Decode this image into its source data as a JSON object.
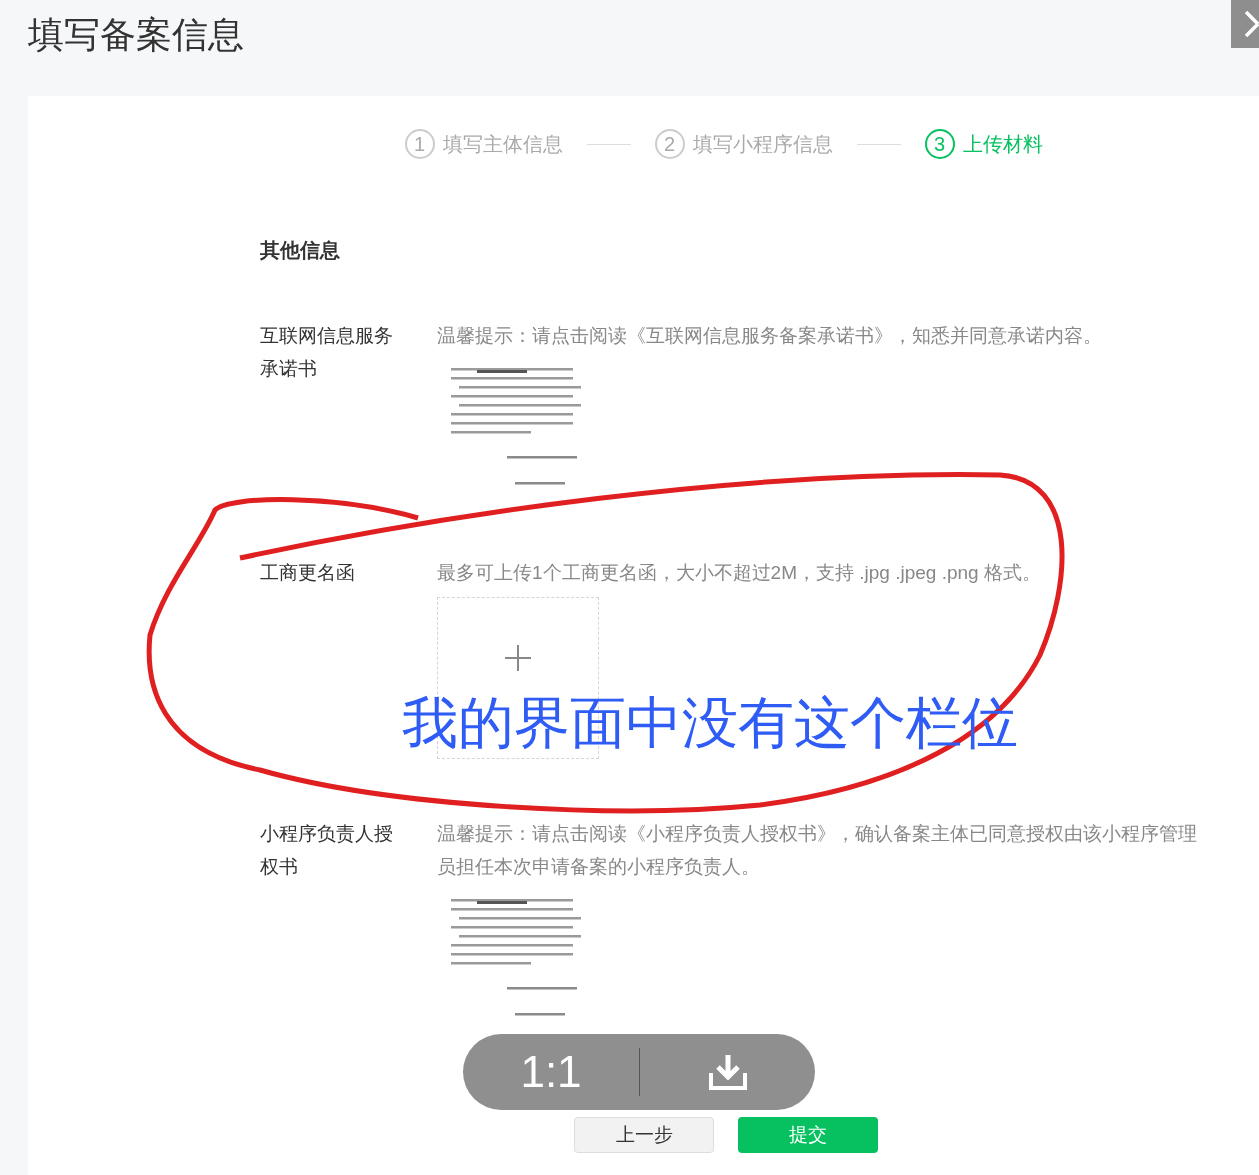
{
  "page_title": "填写备案信息",
  "steps": [
    {
      "number": "1",
      "label": "填写主体信息",
      "selected": false
    },
    {
      "number": "2",
      "label": "填写小程序信息",
      "selected": false
    },
    {
      "number": "3",
      "label": "上传材料",
      "selected": true
    }
  ],
  "section_title": "其他信息",
  "fields": [
    {
      "kind": "document",
      "label": "互联网信息服务承诺书",
      "hint": "温馨提示：请点击阅读《互联网信息服务备案承诺书》，知悉并同意承诺内容。"
    },
    {
      "kind": "upload",
      "label": "工商更名函",
      "hint": "最多可上传1个工商更名函，大小不超过2M，支持 .jpg .jpeg .png 格式。"
    },
    {
      "kind": "document",
      "label": "小程序负责人授权书",
      "hint": "温馨提示：请点击阅读《小程序负责人授权书》，确认备案主体已同意授权由该小程序管理员担任本次申请备案的小程序负责人。"
    }
  ],
  "buttons": [
    {
      "label": "上一步",
      "kind": "secondary"
    },
    {
      "label": "提交",
      "kind": "primary"
    }
  ],
  "viewer_toolbar": {
    "zoom_label": "1:1"
  },
  "annotation": {
    "text": "我的界面中没有这个栏位"
  }
}
